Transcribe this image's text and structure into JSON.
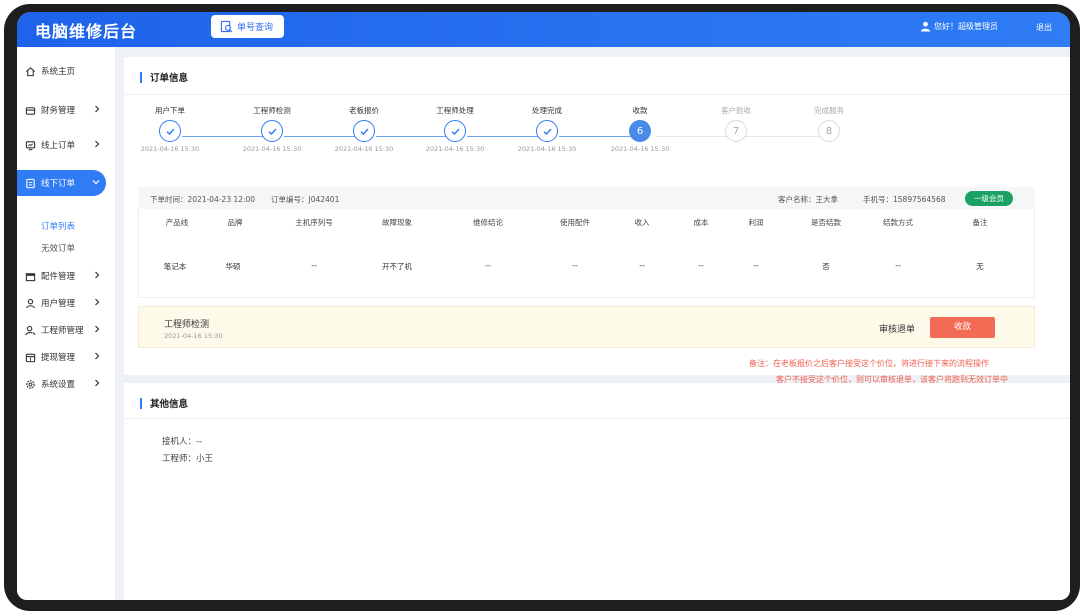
{
  "header": {
    "title": "电脑维修后台",
    "search_button": "单号查询",
    "greeting": "您好！超级管理员",
    "logout": "退出"
  },
  "sidebar": {
    "items": [
      {
        "label": "系统主页",
        "icon": "home-icon",
        "chevron": false
      },
      {
        "label": "财务管理",
        "icon": "wallet-icon",
        "chevron": true
      },
      {
        "label": "线上订单",
        "icon": "monitor-icon",
        "chevron": true
      },
      {
        "label": "线下订单",
        "icon": "document-icon",
        "chevron": true,
        "active": true,
        "expanded": true
      },
      {
        "label": "配件管理",
        "icon": "box-icon",
        "chevron": true
      },
      {
        "label": "用户管理",
        "icon": "user-icon",
        "chevron": true
      },
      {
        "label": "工程师管理",
        "icon": "engineer-icon",
        "chevron": true
      },
      {
        "label": "提现管理",
        "icon": "withdraw-icon",
        "chevron": true
      },
      {
        "label": "系统设置",
        "icon": "gear-icon",
        "chevron": true
      }
    ],
    "sub_items": [
      {
        "label": "订单列表",
        "active": true
      },
      {
        "label": "无效订单",
        "active": false
      }
    ]
  },
  "order_info": {
    "title": "订单信息",
    "steps": [
      {
        "label": "用户下单",
        "time": "2021-04-16 15:30",
        "state": "done"
      },
      {
        "label": "工程师检测",
        "time": "2021-04-16 15:30",
        "state": "done"
      },
      {
        "label": "老板报价",
        "time": "2021-04-16 15:30",
        "state": "done"
      },
      {
        "label": "工程师处理",
        "time": "2021-04-16 15:30",
        "state": "done"
      },
      {
        "label": "处理完成",
        "time": "2021-04-16 15:30",
        "state": "done"
      },
      {
        "label": "收款",
        "time": "2021-04-16 15:30",
        "state": "current",
        "number": "6"
      },
      {
        "label": "客户验收",
        "time": "",
        "state": "pending",
        "number": "7"
      },
      {
        "label": "完成服务",
        "time": "",
        "state": "pending",
        "number": "8"
      }
    ],
    "meta": {
      "order_time": "下单时间：2021-04-23 12:00",
      "order_no": "订单编号：J042401",
      "customer": "客户名称：王大拿",
      "phone": "手机号：15897564568",
      "member_level": "一级会员"
    },
    "table": {
      "headers": [
        "产品线",
        "品牌",
        "主机序列号",
        "故障现象",
        "维修结论",
        "使用配件",
        "收入",
        "成本",
        "利润",
        "是否结款",
        "结款方式",
        "备注"
      ],
      "row": [
        "笔记本",
        "华硕",
        "--",
        "开不了机",
        "--",
        "--",
        "--",
        "--",
        "--",
        "否",
        "--",
        "无"
      ]
    },
    "status_panel": {
      "step_name": "工程师检测",
      "time": "2021-04-16 15:30",
      "reject_label": "审核退单",
      "collect_label": "收款"
    },
    "notes": [
      "备注：在老板报价之后客户接受这个价位，将进行接下来的流程操作",
      "客户不接受这个价位，则可以审核退单，该客户将跑到无效订单中"
    ]
  },
  "other_info": {
    "title": "其他信息",
    "receiver": "接机人：--",
    "engineer": "工程师：小王"
  }
}
